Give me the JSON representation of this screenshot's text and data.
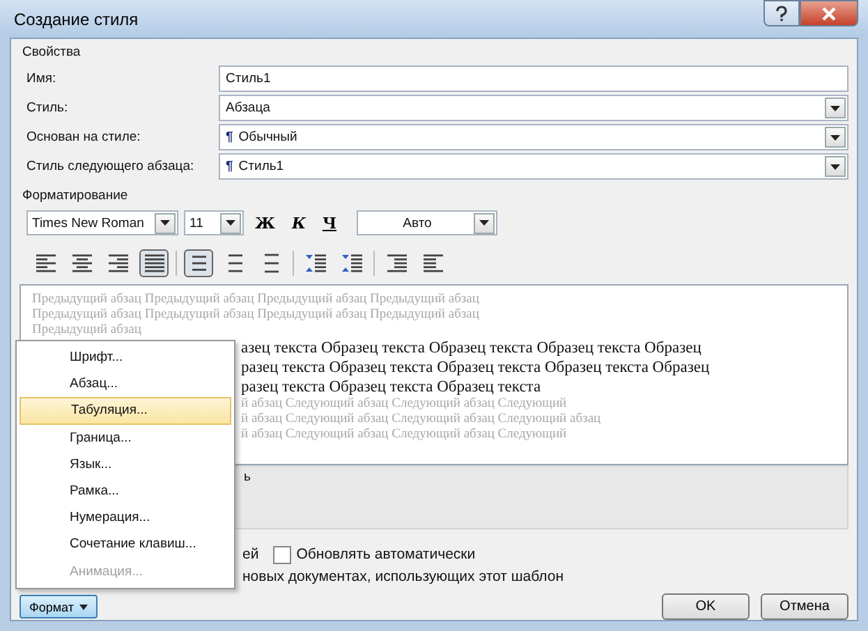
{
  "window": {
    "title": "Создание стиля"
  },
  "properties": {
    "title": "Свойства",
    "fields": [
      {
        "label": "Имя:",
        "value": "Стиль1",
        "kind": "text"
      },
      {
        "label": "Стиль:",
        "value": "Абзаца",
        "kind": "select"
      },
      {
        "label": "Основан на стиле:",
        "value": "Обычный",
        "kind": "select",
        "marker": "¶"
      },
      {
        "label": "Стиль следующего абзаца:",
        "value": "Стиль1",
        "kind": "select",
        "marker": "¶"
      }
    ]
  },
  "formatting": {
    "title": "Форматирование",
    "font": "Times New Roman",
    "size": "11",
    "bold": "Ж",
    "italic": "К",
    "underline": "Ч",
    "text_shade": "Авто",
    "align_buttons": [
      {
        "kind": "align-left",
        "selected": false
      },
      {
        "kind": "align-center",
        "selected": false
      },
      {
        "kind": "align-right",
        "selected": false
      },
      {
        "kind": "align-justify",
        "selected": true
      },
      {
        "kind": "spacing-single",
        "selected": true
      },
      {
        "kind": "spacing-onehalf",
        "selected": false
      },
      {
        "kind": "spacing-double",
        "selected": false
      },
      {
        "kind": "space-before",
        "selected": false
      },
      {
        "kind": "space-after",
        "selected": false
      },
      {
        "kind": "indent-decrease",
        "selected": false
      },
      {
        "kind": "indent-increase",
        "selected": false
      }
    ]
  },
  "preview": {
    "previous": [
      "Предыдущий абзац Предыдущий абзац Предыдущий абзац Предыдущий абзац",
      "Предыдущий абзац Предыдущий абзац Предыдущий абзац Предыдущий абзац",
      "Предыдущий абзац"
    ],
    "sample": [
      "азец текста Образец текста Образец текста Образец текста Образец",
      "разец текста Образец текста Образец текста Образец текста Образец",
      "разец текста Образец текста Образец текста"
    ],
    "next": [
      "й абзац Следующий абзац Следующий абзац Следующий",
      "й абзац Следующий абзац Следующий абзац Следующий абзац",
      "й абзац Следующий абзац Следующий абзац Следующий"
    ]
  },
  "description": "ь",
  "options": {
    "fragment": "ей",
    "auto_update": {
      "label": "Обновлять автоматически",
      "checked": false
    },
    "template_text": "новых документах, использующих этот шаблон"
  },
  "format_menu": {
    "button": "Формат",
    "items": [
      {
        "label": "Шрифт...",
        "selected": false,
        "disabled": false
      },
      {
        "label": "Абзац...",
        "selected": false,
        "disabled": false
      },
      {
        "label": "Табуляция...",
        "selected": true,
        "disabled": false
      },
      {
        "label": "Граница...",
        "selected": false,
        "disabled": false
      },
      {
        "label": "Язык...",
        "selected": false,
        "disabled": false
      },
      {
        "label": "Рамка...",
        "selected": false,
        "disabled": false
      },
      {
        "label": "Нумерация...",
        "selected": false,
        "disabled": false
      },
      {
        "label": "Сочетание клавиш...",
        "selected": false,
        "disabled": false
      },
      {
        "label": "Анимация...",
        "selected": false,
        "disabled": true
      }
    ]
  },
  "buttons": [
    "OK",
    "Отмена"
  ]
}
